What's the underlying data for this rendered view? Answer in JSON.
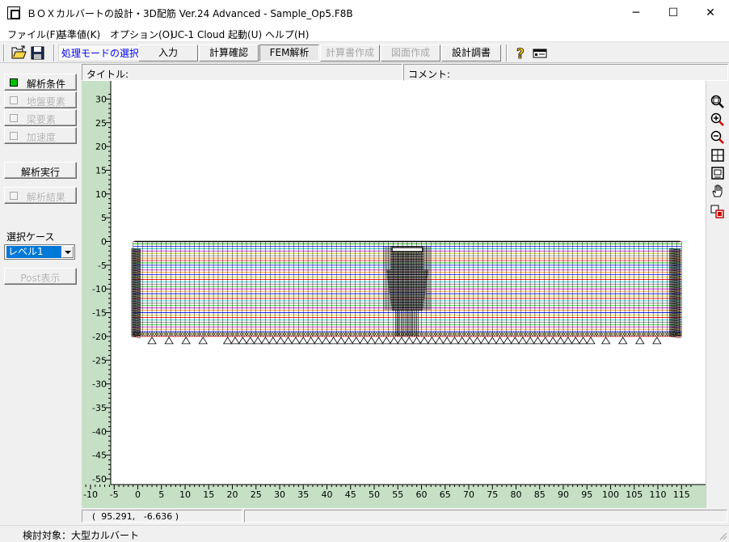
{
  "window": {
    "title": "ＢＯＸカルバートの設計・3D配筋 Ver.24 Advanced - Sample_Op5.F8B",
    "minimize": "─",
    "maximize": "☐",
    "close": "✕"
  },
  "menu": [
    "ファイル(F)",
    "基準値(K)",
    "オプション(O)",
    "UC-1 Cloud 起動(U)",
    "ヘルプ(H)"
  ],
  "toolbar": {
    "mode_label": "処理モードの選択",
    "modes": [
      {
        "label": "入力",
        "state": "normal"
      },
      {
        "label": "計算確認",
        "state": "normal"
      },
      {
        "label": "FEM解析",
        "state": "active"
      },
      {
        "label": "計算書作成",
        "state": "disabled"
      },
      {
        "label": "図面作成",
        "state": "disabled"
      },
      {
        "label": "設計調書",
        "state": "normal"
      }
    ],
    "icons": [
      "open-folder-icon",
      "save-icon",
      "help-icon",
      "info-card-icon"
    ]
  },
  "side_panel": {
    "analysis_conditions": "解析条件",
    "ground_elements": "地盤要素",
    "beam_elements": "梁要素",
    "acceleration": "加速度",
    "run_analysis": "解析実行",
    "analysis_results": "解析結果",
    "case_label": "選択ケース",
    "case_value": "レベル1",
    "post_display": "Post表示"
  },
  "info": {
    "title_label": "タイトル:",
    "comment_label": "コメント:"
  },
  "plot": {
    "x_ticks": [
      "-10",
      "-5",
      "0",
      "5",
      "10",
      "15",
      "20",
      "25",
      "30",
      "35",
      "40",
      "45",
      "50",
      "55",
      "60",
      "65",
      "70",
      "75",
      "80",
      "85",
      "90",
      "95",
      "100",
      "105",
      "110",
      "115"
    ],
    "y_ticks": [
      "30",
      "25",
      "20",
      "15",
      "10",
      "5",
      "0",
      "-5",
      "-10",
      "-15",
      "-20",
      "-25",
      "-30",
      "-35",
      "-40",
      "-45",
      "-50"
    ],
    "axis_color": "#c6e0c6",
    "layer_colors": [
      "#ff0000",
      "#00c000",
      "#0000ff",
      "#00c0c0",
      "#c000c0",
      "#c0c000",
      "#808080",
      "#ff8000"
    ]
  },
  "view_tools": [
    "zoom-fit-icon",
    "zoom-in-icon",
    "zoom-out-icon",
    "zoom-window-icon",
    "zoom-all-icon",
    "pan-hand-icon",
    "select-node-icon"
  ],
  "coords": "(  95.291,   -6.636 )",
  "status": "検討対象：大型カルバート"
}
